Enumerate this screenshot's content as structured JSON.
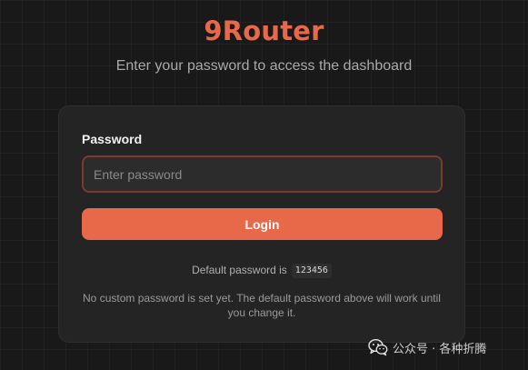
{
  "header": {
    "app_title": "9Router",
    "subtitle": "Enter your password to access the dashboard"
  },
  "login_form": {
    "password_label": "Password",
    "password_placeholder": "Enter password",
    "password_value": "",
    "login_button_label": "Login",
    "default_password_text": "Default password is",
    "default_password_value": "123456",
    "note": "No custom password is set yet. The default password above will work until you change it."
  },
  "watermark": {
    "icon": "wechat-icon",
    "text": "公众号 · 各种折腾"
  },
  "colors": {
    "accent": "#e8694a",
    "background": "#191919",
    "card": "#242424",
    "input_border": "#7a3b2c"
  }
}
